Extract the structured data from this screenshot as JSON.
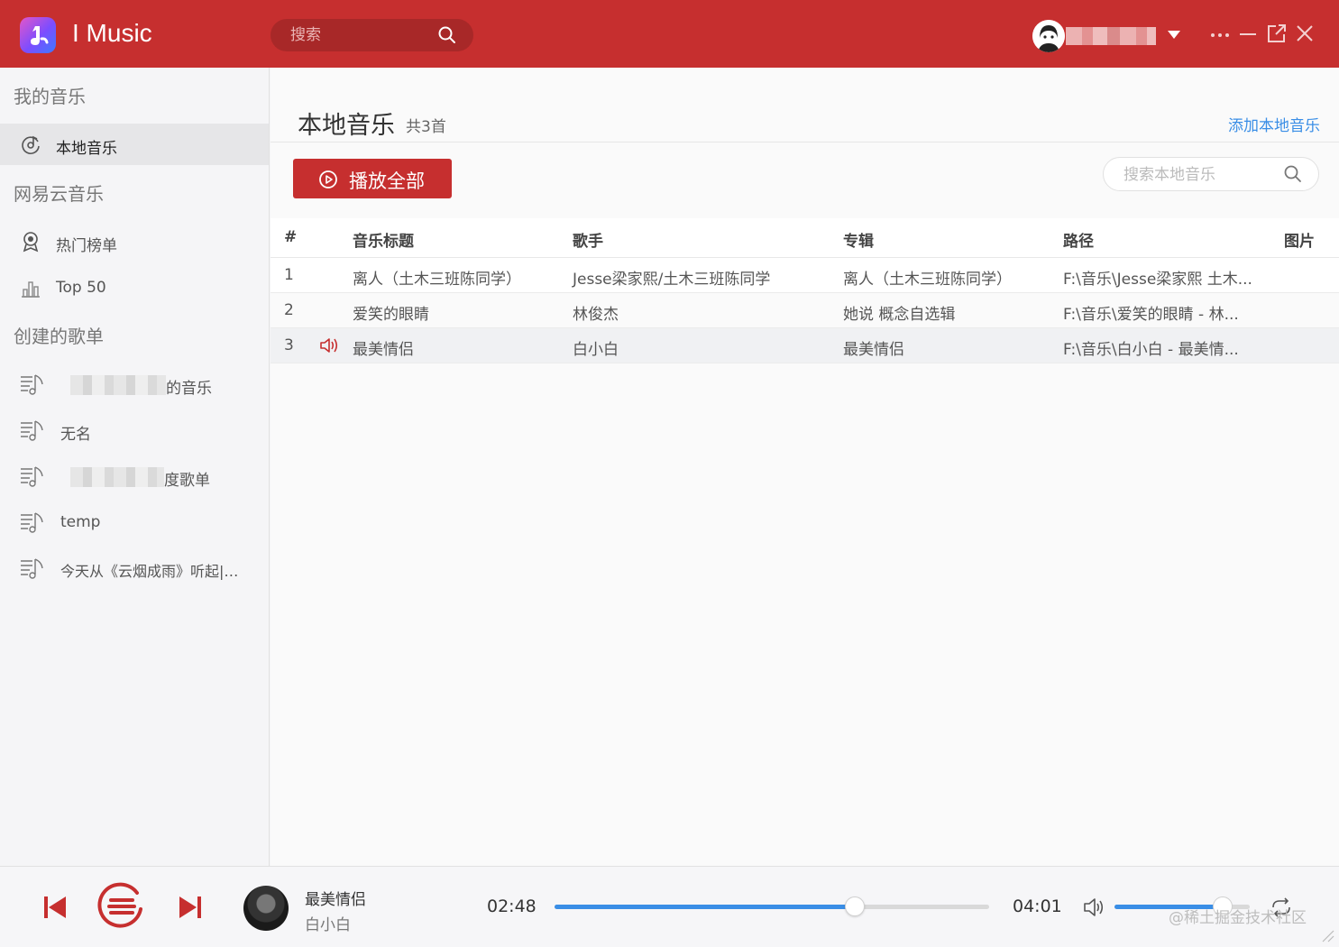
{
  "app": {
    "title": "I Music"
  },
  "header": {
    "search_placeholder": "搜索",
    "window_buttons": [
      "more-icon",
      "minimize-icon",
      "popout-icon",
      "close-icon"
    ]
  },
  "sidebar": {
    "sections": [
      {
        "title": "我的音乐",
        "items": [
          {
            "label": "本地音乐",
            "icon": "local-music-icon",
            "active": true
          }
        ]
      },
      {
        "title": "网易云音乐",
        "items": [
          {
            "label": "热门榜单",
            "icon": "chart-ranking-icon"
          },
          {
            "label": "Top 50",
            "icon": "bar-chart-icon"
          }
        ]
      },
      {
        "title": "创建的歌单",
        "items": [
          {
            "label": "的音乐",
            "icon": "playlist-icon",
            "obscured": true
          },
          {
            "label": "无名",
            "icon": "playlist-icon"
          },
          {
            "label": "度歌单",
            "icon": "playlist-icon",
            "obscured": true
          },
          {
            "label": "temp",
            "icon": "playlist-icon"
          },
          {
            "label": "今天从《云烟成雨》听起|…",
            "icon": "playlist-icon"
          }
        ]
      }
    ]
  },
  "main": {
    "title": "本地音乐",
    "count": "共3首",
    "add_link": "添加本地音乐",
    "play_all": "播放全部",
    "search_placeholder": "搜索本地音乐",
    "columns": [
      "#",
      "音乐标题",
      "歌手",
      "专辑",
      "路径",
      "图片"
    ],
    "rows": [
      {
        "num": "1",
        "title": "离人（土木三班陈同学）",
        "artist": "Jesse梁家熙/土木三班陈同学",
        "album": "离人（土木三班陈同学）",
        "path": "F:\\音乐\\Jesse梁家熙 土木...",
        "playing": false
      },
      {
        "num": "2",
        "title": "爱笑的眼睛",
        "artist": "林俊杰",
        "album": "她说 概念自选辑",
        "path": "F:\\音乐\\爱笑的眼睛 - 林...",
        "playing": false
      },
      {
        "num": "3",
        "title": "最美情侣",
        "artist": "白小白",
        "album": "最美情侣",
        "path": "F:\\音乐\\白小白 - 最美情...",
        "playing": true
      }
    ]
  },
  "player": {
    "song": "最美情侣",
    "artist": "白小白",
    "current_time": "02:48",
    "total_time": "04:01",
    "progress": 0.69,
    "volume": 0.8,
    "watermark": "@稀土掘金技术社区",
    "colors": {
      "accent": "#c62f2f",
      "progress": "#3a8ee6"
    }
  }
}
